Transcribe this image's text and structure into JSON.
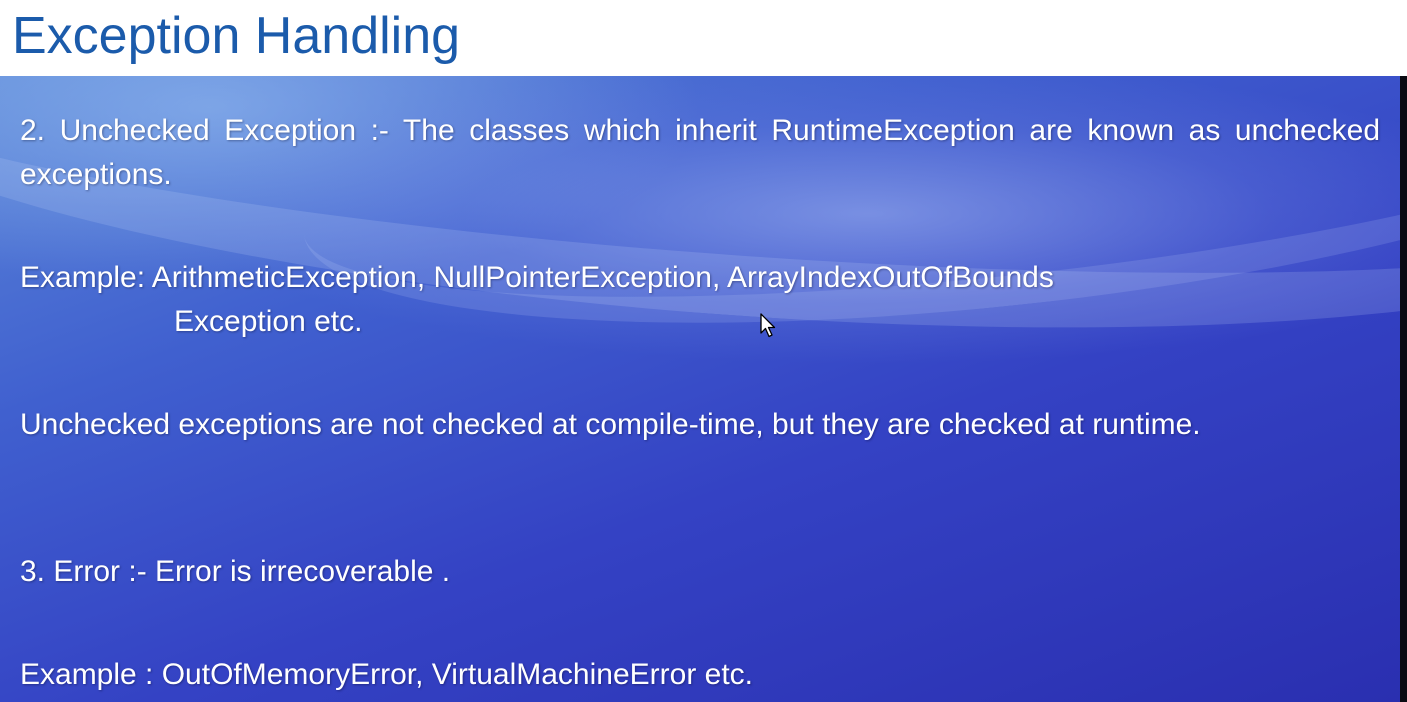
{
  "slide": {
    "title": "Exception Handling",
    "paragraphs": {
      "unchecked_definition": "2. Unchecked Exception :- The classes which inherit RuntimeException are known as unchecked exceptions.",
      "unchecked_example_line1": "Example: ArithmeticException, NullPointerException, ArrayIndexOutOfBounds",
      "unchecked_example_line2": "Exception etc.",
      "unchecked_note": "Unchecked exceptions are not checked at compile-time, but they are checked at runtime.",
      "error_definition": "3. Error :- Error is irrecoverable .",
      "error_example": "Example : OutOfMemoryError, VirtualMachineError etc."
    }
  },
  "icons": {
    "cursor": "mouse-pointer-icon"
  },
  "colors": {
    "title": "#1b5bab",
    "body_text": "#ffffff",
    "background_dark": "#2a2fb0",
    "background_light": "#5b86d8"
  }
}
